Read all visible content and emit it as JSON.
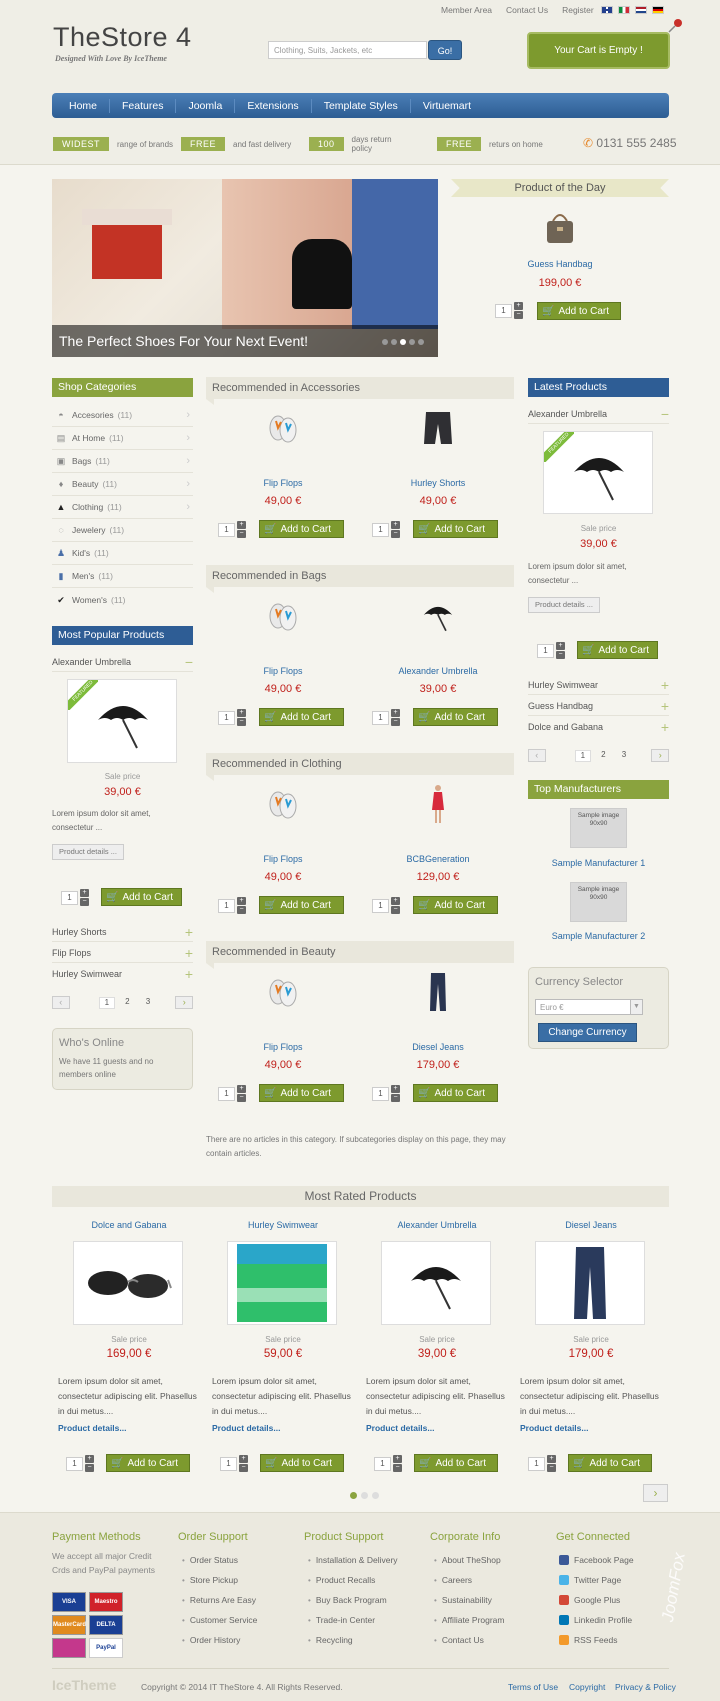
{
  "header": {
    "top_links": [
      "Member Area",
      "Contact Us",
      "Register"
    ],
    "logo": "TheStore 4",
    "tagline": "Designed With Love By IceTheme",
    "search_placeholder": "Clothing, Suits, Jackets, etc",
    "search_button": "Go!",
    "cart_label": "Your Cart is Empty !",
    "flags": [
      "#23408e",
      "#0b8a3d",
      "#ae1c28",
      "#000000"
    ]
  },
  "nav": [
    "Home",
    "Features",
    "Joomla",
    "Extensions",
    "Template Styles",
    "Virtuemart"
  ],
  "promos": [
    {
      "badge": "WIDEST",
      "text": "range of brands"
    },
    {
      "badge": "FREE",
      "text": "and fast delivery"
    },
    {
      "badge": "100",
      "text": "days return policy"
    },
    {
      "badge": "FREE",
      "text": "returs on home"
    }
  ],
  "phone": "0131 555 2485",
  "slider": {
    "caption": "The Perfect Shoes For Your Next Event!"
  },
  "potd": {
    "title": "Product of the Day",
    "name": "Guess Handbag",
    "price": "199,00 €",
    "qty": "1"
  },
  "add_to_cart": "Add to Cart",
  "shop_categories": {
    "title": "Shop Categories",
    "items": [
      {
        "name": "Accesories",
        "count": "(11)"
      },
      {
        "name": "At Home",
        "count": "(11)"
      },
      {
        "name": "Bags",
        "count": "(11)"
      },
      {
        "name": "Beauty",
        "count": "(11)"
      },
      {
        "name": "Clothing",
        "count": "(11)"
      },
      {
        "name": "Jewelery",
        "count": "(11)"
      },
      {
        "name": "Kid's",
        "count": "(11)"
      },
      {
        "name": "Men's",
        "count": "(11)"
      },
      {
        "name": "Women's",
        "count": "(11)"
      }
    ]
  },
  "most_popular": {
    "title": "Most Popular Products",
    "first": "Alexander Umbrella",
    "badge": "FEATURED",
    "sale_label": "Sale price",
    "price": "39,00 €",
    "desc": "Lorem ipsum dolor sit amet, consectetur ...",
    "details": "Product details ...",
    "qty": "1",
    "others": [
      "Hurley Shorts",
      "Flip Flops",
      "Hurley Swimwear"
    ],
    "pages": [
      "1",
      "2",
      "3"
    ]
  },
  "whos_online": {
    "title": "Who's Online",
    "text": "We have 11 guests and no members online"
  },
  "recommended": [
    {
      "title": "Recommended in Accessories",
      "products": [
        {
          "name": "Flip Flops",
          "price": "49,00 €"
        },
        {
          "name": "Hurley Shorts",
          "price": "49,00 €"
        }
      ]
    },
    {
      "title": "Recommended in Bags",
      "products": [
        {
          "name": "Flip Flops",
          "price": "49,00 €"
        },
        {
          "name": "Alexander Umbrella",
          "price": "39,00 €"
        }
      ]
    },
    {
      "title": "Recommended in Clothing",
      "products": [
        {
          "name": "Flip Flops",
          "price": "49,00 €"
        },
        {
          "name": "BCBGeneration",
          "price": "129,00 €"
        }
      ]
    },
    {
      "title": "Recommended in Beauty",
      "products": [
        {
          "name": "Flip Flops",
          "price": "49,00 €"
        },
        {
          "name": "Diesel Jeans",
          "price": "179,00 €"
        }
      ]
    }
  ],
  "no_articles": "There are no articles in this category. If subcategories display on this page, they may contain articles.",
  "latest": {
    "title": "Latest Products",
    "first": "Alexander Umbrella",
    "badge": "FEATURED",
    "sale_label": "Sale price",
    "price": "39,00 €",
    "desc": "Lorem ipsum dolor sit amet, consectetur ...",
    "details": "Product details ...",
    "qty": "1",
    "others": [
      "Hurley Swimwear",
      "Guess Handbag",
      "Dolce and Gabana"
    ],
    "pages": [
      "1",
      "2",
      "3"
    ]
  },
  "manufacturers": {
    "title": "Top Manufacturers",
    "img_text": "Sample image 90x90",
    "items": [
      "Sample Manufacturer 1",
      "Sample Manufacturer 2"
    ]
  },
  "currency": {
    "title": "Currency Selector",
    "selected": "Euro €",
    "button": "Change Currency"
  },
  "most_rated": {
    "title": "Most Rated Products",
    "sale_label": "Sale price",
    "desc": "Lorem ipsum dolor sit amet, consectetur adipiscing elit. Phasellus in dui metus....",
    "details": "Product details...",
    "items": [
      {
        "name": "Dolce and Gabana",
        "price": "169,00 €"
      },
      {
        "name": "Hurley Swimwear",
        "price": "59,00 €"
      },
      {
        "name": "Alexander Umbrella",
        "price": "39,00 €"
      },
      {
        "name": "Diesel Jeans",
        "price": "179,00 €"
      }
    ]
  },
  "footer": {
    "cols": [
      {
        "title": "Payment Methods",
        "text": "We accept all major Credit Crds and PayPal payments"
      },
      {
        "title": "Order Support",
        "items": [
          "Order Status",
          "Store Pickup",
          "Returns Are Easy",
          "Customer Service",
          "Order History"
        ]
      },
      {
        "title": "Product Support",
        "items": [
          "Installation & Delivery",
          "Product Recalls",
          "Buy Back Program",
          "Trade-in Center",
          "Recycling"
        ]
      },
      {
        "title": "Corporate Info",
        "items": [
          "About TheShop",
          "Careers",
          "Sustainability",
          "Affiliate Program",
          "Contact Us"
        ]
      },
      {
        "title": "Get Connected",
        "items": [
          "Facebook Page",
          "Twitter Page",
          "Google Plus",
          "Linkedin Profile",
          "RSS Feeds"
        ]
      }
    ],
    "cards": [
      "VISA",
      "Maestro",
      "MasterCard",
      "DELTA",
      "",
      "PayPal"
    ],
    "brand": "IceTheme",
    "copyright": "Copyright © 2014 IT TheStore 4. All Rights Reserved.",
    "links": [
      "Terms of Use",
      "Copyright",
      "Privacy & Policy"
    ],
    "watermark": "JoomFox"
  }
}
